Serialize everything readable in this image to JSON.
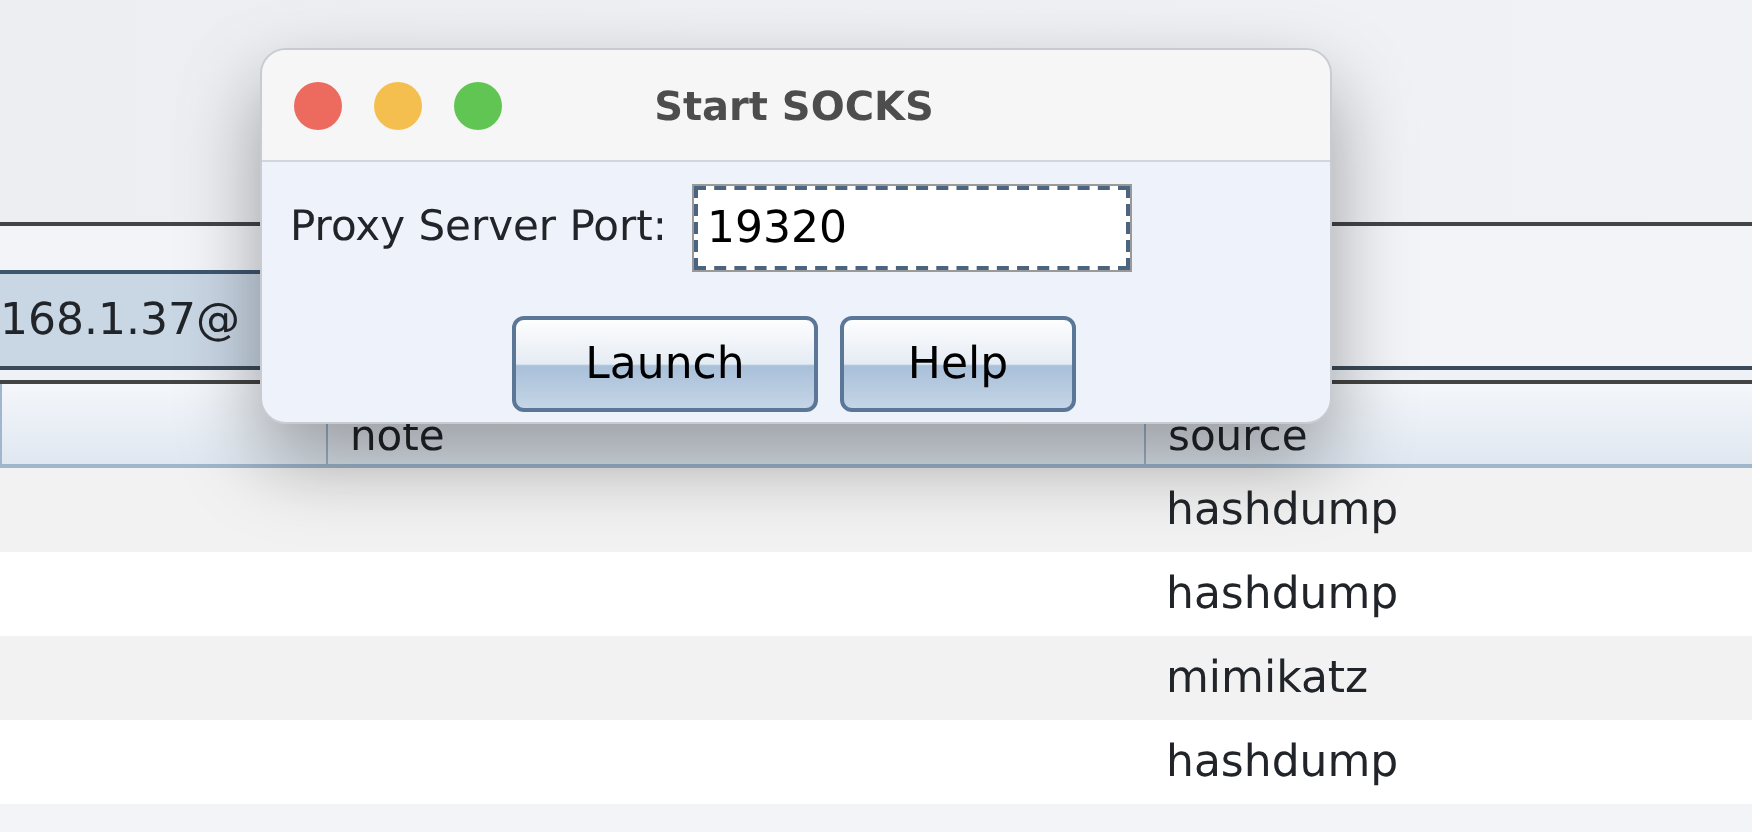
{
  "background_window": {
    "tab": {
      "label": "168.1.37@",
      "selected": true
    },
    "table": {
      "columns": [
        "note",
        "source"
      ],
      "rows": [
        {
          "source": "hashdump"
        },
        {
          "source": "hashdump"
        },
        {
          "source": "mimikatz"
        },
        {
          "source": "hashdump"
        }
      ]
    }
  },
  "dialog": {
    "title": "Start SOCKS",
    "field": {
      "label": "Proxy Server Port:",
      "value": "19320"
    },
    "buttons": [
      "Launch",
      "Help"
    ]
  }
}
